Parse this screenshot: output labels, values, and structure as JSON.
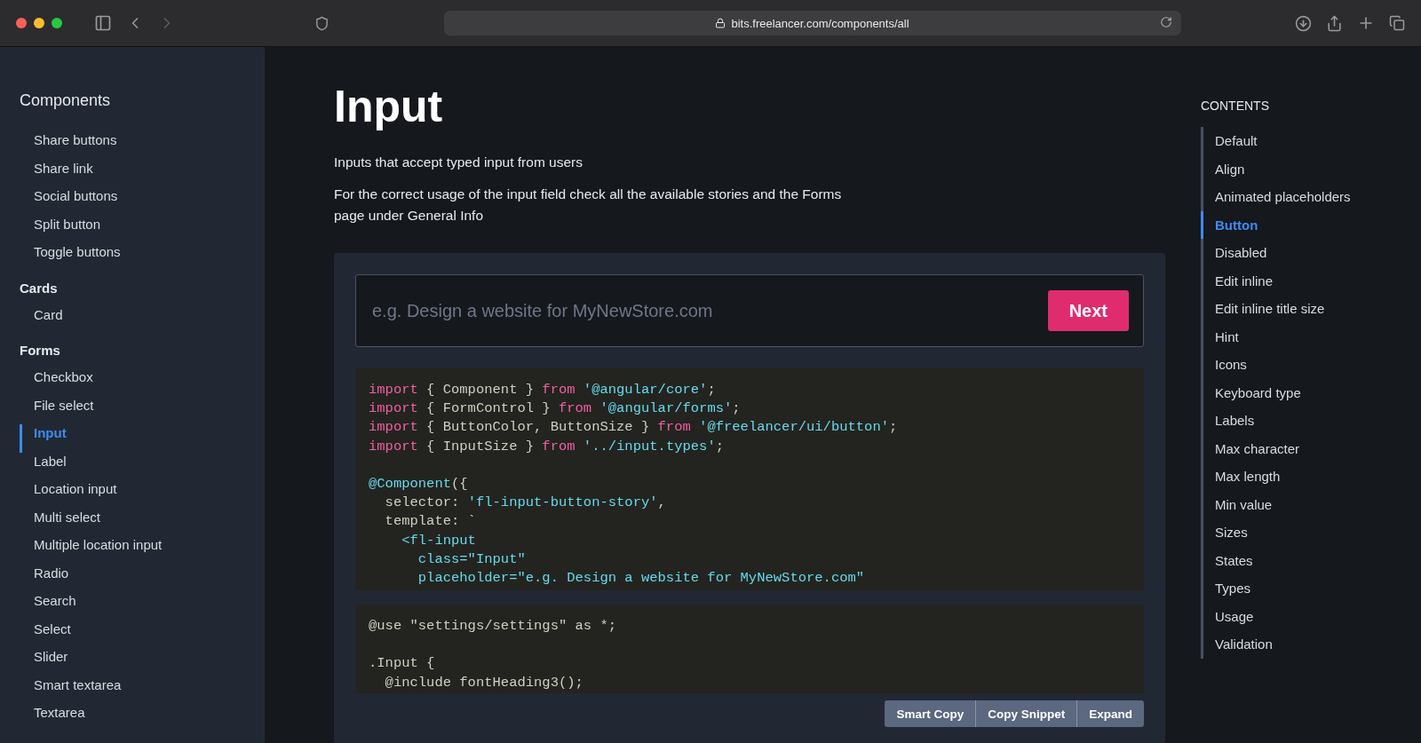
{
  "browser": {
    "url": "bits.freelancer.com/components/all"
  },
  "sidebar": {
    "title": "Components",
    "groups": [
      {
        "items": [
          {
            "label": "Share buttons",
            "selected": false
          },
          {
            "label": "Share link",
            "selected": false
          },
          {
            "label": "Social buttons",
            "selected": false
          },
          {
            "label": "Split button",
            "selected": false
          },
          {
            "label": "Toggle buttons",
            "selected": false
          }
        ]
      },
      {
        "heading": "Cards",
        "items": [
          {
            "label": "Card",
            "selected": false
          }
        ]
      },
      {
        "heading": "Forms",
        "items": [
          {
            "label": "Checkbox",
            "selected": false
          },
          {
            "label": "File select",
            "selected": false
          },
          {
            "label": "Input",
            "selected": true
          },
          {
            "label": "Label",
            "selected": false
          },
          {
            "label": "Location input",
            "selected": false
          },
          {
            "label": "Multi select",
            "selected": false
          },
          {
            "label": "Multiple location input",
            "selected": false
          },
          {
            "label": "Radio",
            "selected": false
          },
          {
            "label": "Search",
            "selected": false
          },
          {
            "label": "Select",
            "selected": false
          },
          {
            "label": "Slider",
            "selected": false
          },
          {
            "label": "Smart textarea",
            "selected": false
          },
          {
            "label": "Textarea",
            "selected": false
          }
        ]
      }
    ]
  },
  "page": {
    "title": "Input",
    "description": "Inputs that accept typed input from users",
    "note": "For the correct usage of the input field check all the available stories and the Forms page under General Info"
  },
  "demo": {
    "placeholder": "e.g. Design a website for MyNewStore.com",
    "button": "Next"
  },
  "code": [
    [
      {
        "kind": "keyword",
        "text": "import"
      },
      {
        "kind": "plain",
        "text": " { Component } "
      },
      {
        "kind": "keyword",
        "text": "from"
      },
      {
        "kind": "string",
        "text": " '@angular/core'"
      },
      {
        "kind": "plain",
        "text": ";"
      }
    ],
    [
      {
        "kind": "keyword",
        "text": "import"
      },
      {
        "kind": "plain",
        "text": " { FormControl } "
      },
      {
        "kind": "keyword",
        "text": "from"
      },
      {
        "kind": "string",
        "text": " '@angular/forms'"
      },
      {
        "kind": "plain",
        "text": ";"
      }
    ],
    [
      {
        "kind": "keyword",
        "text": "import"
      },
      {
        "kind": "plain",
        "text": " { ButtonColor, ButtonSize } "
      },
      {
        "kind": "keyword",
        "text": "from"
      },
      {
        "kind": "string",
        "text": " '@freelancer/ui/button'"
      },
      {
        "kind": "plain",
        "text": ";"
      }
    ],
    [
      {
        "kind": "keyword",
        "text": "import"
      },
      {
        "kind": "plain",
        "text": " { InputSize } "
      },
      {
        "kind": "keyword",
        "text": "from"
      },
      {
        "kind": "string",
        "text": " '../input.types'"
      },
      {
        "kind": "plain",
        "text": ";"
      }
    ],
    {
      "gap_before": true,
      "tokens": [
        {
          "kind": "string",
          "text": "@Component"
        },
        {
          "kind": "plain",
          "text": "({"
        }
      ]
    },
    [
      {
        "kind": "plain",
        "text": "  selector: "
      },
      {
        "kind": "string",
        "text": "'fl-input-button-story'"
      },
      {
        "kind": "plain",
        "text": ","
      }
    ],
    [
      {
        "kind": "plain",
        "text": "  template: `"
      }
    ],
    [
      {
        "kind": "string",
        "text": "    <fl-input"
      }
    ],
    [
      {
        "kind": "string",
        "text": "      class=\"Input\""
      }
    ],
    [
      {
        "kind": "string",
        "text": "      placeholder=\"e.g. Design a website for MyNewStore.com\""
      }
    ]
  ],
  "styles": [
    [
      {
        "kind": "plain",
        "text": "@use \"settings/settings\" as *;"
      }
    ],
    {
      "gap_before": true,
      "tokens": [
        {
          "kind": "plain",
          "text": ".Input {"
        }
      ]
    },
    [
      {
        "kind": "plain",
        "text": "  @include fontHeading3();"
      }
    ]
  ],
  "actions": [
    "Smart Copy",
    "Copy Snippet",
    "Expand"
  ],
  "contents": {
    "title": "CONTENTS",
    "items": [
      {
        "label": "Default",
        "selected": false
      },
      {
        "label": "Align",
        "selected": false
      },
      {
        "label": "Animated placeholders",
        "selected": false
      },
      {
        "label": "Button",
        "selected": true
      },
      {
        "label": "Disabled",
        "selected": false
      },
      {
        "label": "Edit inline",
        "selected": false
      },
      {
        "label": "Edit inline title size",
        "selected": false
      },
      {
        "label": "Hint",
        "selected": false
      },
      {
        "label": "Icons",
        "selected": false
      },
      {
        "label": "Keyboard type",
        "selected": false
      },
      {
        "label": "Labels",
        "selected": false
      },
      {
        "label": "Max character",
        "selected": false
      },
      {
        "label": "Max length",
        "selected": false
      },
      {
        "label": "Min value",
        "selected": false
      },
      {
        "label": "Sizes",
        "selected": false
      },
      {
        "label": "States",
        "selected": false
      },
      {
        "label": "Types",
        "selected": false
      },
      {
        "label": "Usage",
        "selected": false
      },
      {
        "label": "Validation",
        "selected": false
      }
    ]
  }
}
